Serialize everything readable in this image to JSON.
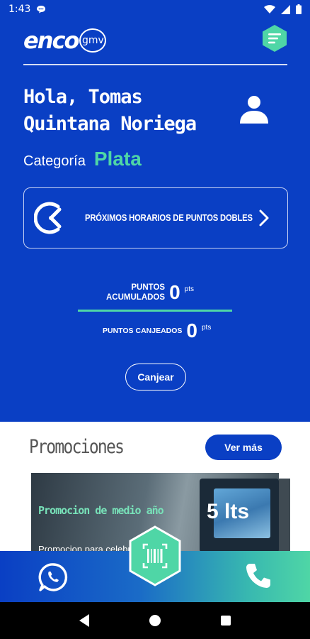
{
  "status_bar": {
    "time": "1:43"
  },
  "header": {
    "logo_text": "enco",
    "logo_badge": "gmv"
  },
  "greeting": "Hola, Tomas Quintana Noriega",
  "category": {
    "label": "Categoría",
    "value": "Plata"
  },
  "double_points": {
    "label": "PRÓXIMOS HORARIOS DE PUNTOS DOBLES"
  },
  "points": {
    "accumulated_label": "PUNTOS\nACUMULADOS",
    "accumulated_value": "0",
    "accumulated_unit": "pts",
    "redeemed_label": "PUNTOS CANJEADOS",
    "redeemed_value": "0",
    "redeemed_unit": "pts"
  },
  "redeem_button": "Canjear",
  "promotions": {
    "title": "Promociones",
    "see_more": "Ver más",
    "card": {
      "title": "Promocion de medio año",
      "value": "5 lts",
      "description": "Promocion para celebr"
    }
  },
  "colors": {
    "primary": "#0a3fc4",
    "accent": "#4fd6a6"
  }
}
